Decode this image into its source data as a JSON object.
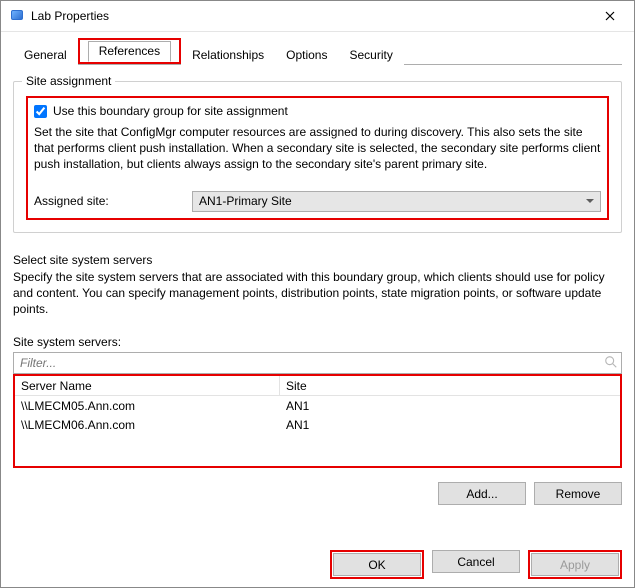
{
  "title": "Lab Properties",
  "tabs": {
    "general": "General",
    "references": "References",
    "relationships": "Relationships",
    "options": "Options",
    "security": "Security"
  },
  "site_assignment": {
    "group_label": "Site assignment",
    "checkbox_label": "Use this boundary group for site assignment",
    "checkbox_checked": true,
    "description": "Set the site that ConfigMgr computer resources are assigned to during discovery. This also sets the site that performs client push installation. When a secondary site is selected, the secondary site performs client push installation, but clients always assign to the secondary site's parent primary site.",
    "assigned_label": "Assigned site:",
    "assigned_value": "AN1-Primary Site"
  },
  "servers": {
    "header": "Select site system servers",
    "description": "Specify the site system servers that are associated with this boundary group, which clients should use for policy and content. You can specify management points, distribution points, state migration points, or software update points.",
    "list_label": "Site system servers:",
    "filter_placeholder": "Filter...",
    "columns": {
      "server": "Server Name",
      "site": "Site"
    },
    "rows": [
      {
        "server": "\\\\LMECM05.Ann.com",
        "site": "AN1"
      },
      {
        "server": "\\\\LMECM06.Ann.com",
        "site": "AN1"
      }
    ],
    "add_label": "Add...",
    "remove_label": "Remove"
  },
  "buttons": {
    "ok": "OK",
    "cancel": "Cancel",
    "apply": "Apply"
  }
}
